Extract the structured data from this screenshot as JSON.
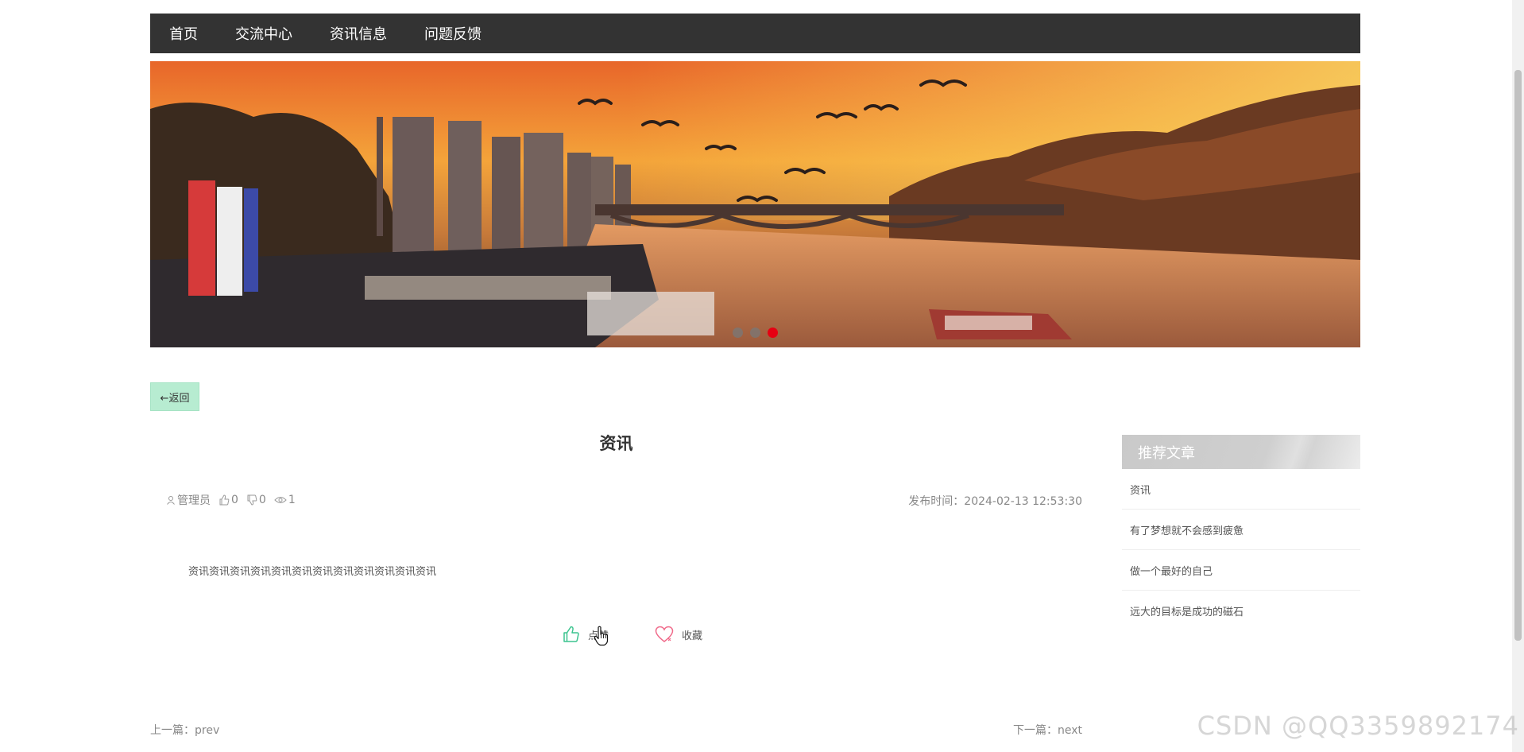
{
  "nav": {
    "items": [
      {
        "label": "首页"
      },
      {
        "label": "交流中心"
      },
      {
        "label": "资讯信息"
      },
      {
        "label": "问题反馈"
      }
    ]
  },
  "banner": {
    "slide_count": 3,
    "active_index": 2
  },
  "back_button": {
    "label": "←返回"
  },
  "article": {
    "title": "资讯",
    "author": "管理员",
    "likes": "0",
    "dislikes": "0",
    "views": "1",
    "publish_time": "发布时间：2024-02-13 12:53:30",
    "content": "资讯资讯资讯资讯资讯资讯资讯资讯资讯资讯资讯资讯"
  },
  "actions": {
    "like_label": "点赞",
    "favorite_label": "收藏"
  },
  "pagination": {
    "prev": "上一篇：prev",
    "next": "下一篇：next"
  },
  "sidebar": {
    "title": "推荐文章",
    "items": [
      {
        "label": "资讯"
      },
      {
        "label": "有了梦想就不会感到疲惫"
      },
      {
        "label": "做一个最好的自己"
      },
      {
        "label": "远大的目标是成功的磁石"
      }
    ]
  },
  "watermark": "CSDN @QQ3359892174",
  "colors": {
    "nav_bg": "#333333",
    "back_button_bg": "#b7ecd1",
    "active_dot": "#e60012",
    "like_icon": "#3cc48f",
    "favorite_icon": "#f06a8a"
  },
  "icons": {
    "author": "user-icon",
    "likes": "thumb-up-icon",
    "dislikes": "thumb-down-icon",
    "views": "eye-icon",
    "like_action": "thumb-up-icon",
    "favorite_action": "heart-icon"
  }
}
